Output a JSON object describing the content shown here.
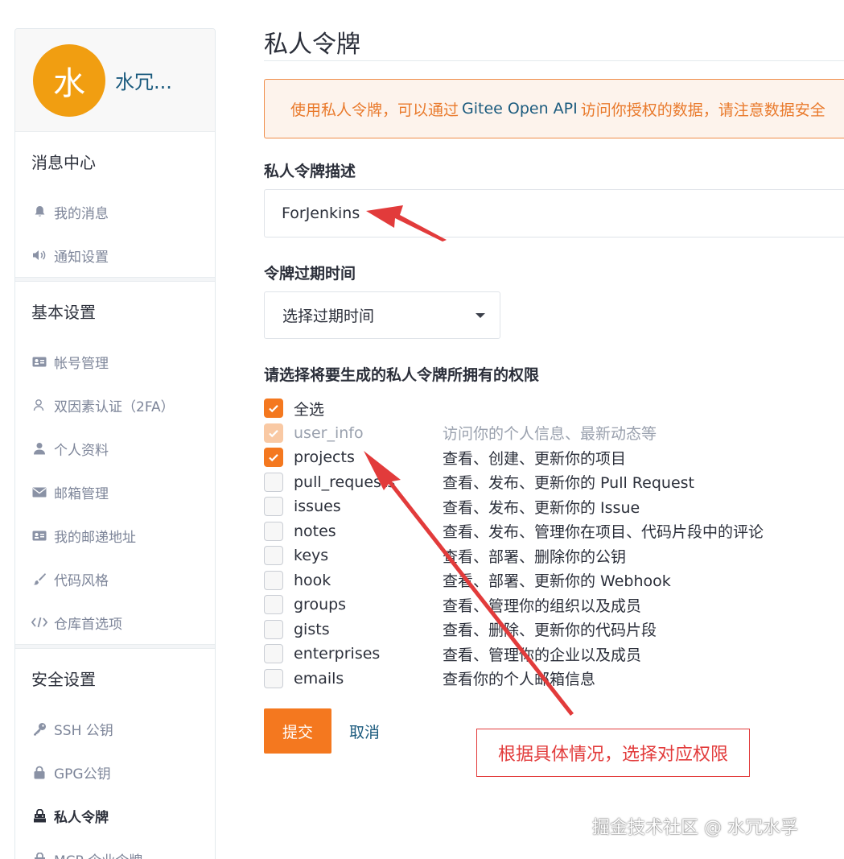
{
  "sidebar": {
    "avatar_char": "水",
    "username": "水冗...",
    "groups": [
      {
        "title": "消息中心",
        "items": [
          {
            "label": "我的消息",
            "icon": "bell-icon"
          },
          {
            "label": "通知设置",
            "icon": "speaker-icon"
          }
        ]
      },
      {
        "title": "基本设置",
        "items": [
          {
            "label": "帐号管理",
            "icon": "id-card-icon"
          },
          {
            "label": "双因素认证（2FA）",
            "icon": "user-outline-icon"
          },
          {
            "label": "个人资料",
            "icon": "user-icon"
          },
          {
            "label": "邮箱管理",
            "icon": "envelope-icon"
          },
          {
            "label": "我的邮递地址",
            "icon": "address-card-icon"
          },
          {
            "label": "代码风格",
            "icon": "brush-icon"
          },
          {
            "label": "仓库首选项",
            "icon": "code-icon"
          }
        ]
      },
      {
        "title": "安全设置",
        "items": [
          {
            "label": "SSH 公钥",
            "icon": "key-icon"
          },
          {
            "label": "GPG公钥",
            "icon": "lock-icon"
          },
          {
            "label": "私人令牌",
            "icon": "token-icon",
            "active": true
          },
          {
            "label": "MCP 企业令牌",
            "icon": "token-icon"
          }
        ]
      }
    ]
  },
  "main": {
    "title": "私人令牌",
    "notice": {
      "prefix": "使用私人令牌，可以通过",
      "highlight": "Gitee Open API",
      "suffix": "访问你授权的数据，请注意数据安全"
    },
    "desc_label": "私人令牌描述",
    "desc_value": "ForJenkins",
    "expire_label": "令牌过期时间",
    "expire_select": "选择过期时间",
    "perm_label": "请选择将要生成的私人令牌所拥有的权限",
    "select_all": "全选",
    "permissions": [
      {
        "name": "user_info",
        "desc": "访问你的个人信息、最新动态等",
        "checked": true,
        "disabled": true
      },
      {
        "name": "projects",
        "desc": "查看、创建、更新你的项目",
        "checked": true,
        "disabled": false
      },
      {
        "name": "pull_requests",
        "desc": "查看、发布、更新你的 Pull Request",
        "checked": false,
        "disabled": false
      },
      {
        "name": "issues",
        "desc": "查看、发布、更新你的 Issue",
        "checked": false,
        "disabled": false
      },
      {
        "name": "notes",
        "desc": "查看、发布、管理你在项目、代码片段中的评论",
        "checked": false,
        "disabled": false
      },
      {
        "name": "keys",
        "desc": "查看、部署、删除你的公钥",
        "checked": false,
        "disabled": false
      },
      {
        "name": "hook",
        "desc": "查看、部署、更新你的 Webhook",
        "checked": false,
        "disabled": false
      },
      {
        "name": "groups",
        "desc": "查看、管理你的组织以及成员",
        "checked": false,
        "disabled": false
      },
      {
        "name": "gists",
        "desc": "查看、删除、更新你的代码片段",
        "checked": false,
        "disabled": false
      },
      {
        "name": "enterprises",
        "desc": "查看、管理你的企业以及成员",
        "checked": false,
        "disabled": false
      },
      {
        "name": "emails",
        "desc": "查看你的个人邮箱信息",
        "checked": false,
        "disabled": false
      }
    ],
    "submit_label": "提交",
    "cancel_label": "取消"
  },
  "annotation": {
    "callout_text": "根据具体情况，选择对应权限",
    "color": "#e23b3b"
  },
  "watermark": "掘金技术社区 @ 水冗水孚",
  "colors": {
    "accent": "#f4781f",
    "link": "#1b5b7e",
    "avatar": "#f19e11"
  }
}
